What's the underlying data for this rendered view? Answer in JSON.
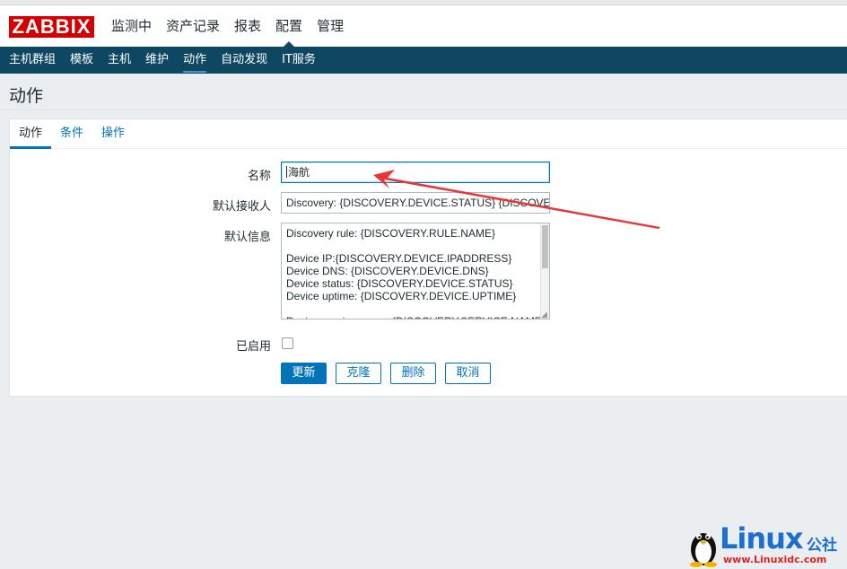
{
  "app": {
    "logo": "ZABBIX"
  },
  "main_menu": [
    {
      "label": "监测中",
      "selected": false
    },
    {
      "label": "资产记录",
      "selected": false
    },
    {
      "label": "报表",
      "selected": false
    },
    {
      "label": "配置",
      "selected": true
    },
    {
      "label": "管理",
      "selected": false
    }
  ],
  "sub_menu": [
    {
      "label": "主机群组",
      "selected": false
    },
    {
      "label": "模板",
      "selected": false
    },
    {
      "label": "主机",
      "selected": false
    },
    {
      "label": "维护",
      "selected": false
    },
    {
      "label": "动作",
      "selected": true
    },
    {
      "label": "自动发现",
      "selected": false
    },
    {
      "label": "IT服务",
      "selected": false
    }
  ],
  "page_title": "动作",
  "tabs": [
    {
      "label": "动作",
      "active": true
    },
    {
      "label": "条件",
      "active": false
    },
    {
      "label": "操作",
      "active": false
    }
  ],
  "form": {
    "name_label": "名称",
    "name_value": "海航",
    "recipient_label": "默认接收人",
    "recipient_value": "Discovery: {DISCOVERY.DEVICE.STATUS} {DISCOVERY.DEVICE.IPADDRESS}",
    "message_label": "默认信息",
    "message_lines": [
      "Discovery rule: {DISCOVERY.RULE.NAME}",
      "",
      "Device IP:{DISCOVERY.DEVICE.IPADDRESS}",
      "Device DNS: {DISCOVERY.DEVICE.DNS}",
      "Device status: {DISCOVERY.DEVICE.STATUS}",
      "Device uptime: {DISCOVERY.DEVICE.UPTIME}",
      "",
      "Device service name: {DISCOVERY.SERVICE.NAME}"
    ],
    "enabled_label": "已启用",
    "enabled_checked": false
  },
  "buttons": {
    "update": "更新",
    "clone": "克隆",
    "delete": "删除",
    "cancel": "取消"
  },
  "annotation": {
    "color": "#e8373b"
  },
  "watermark": {
    "brand": "Linux",
    "brand_cn": "公社",
    "url": "www.Linuxidc.com"
  }
}
